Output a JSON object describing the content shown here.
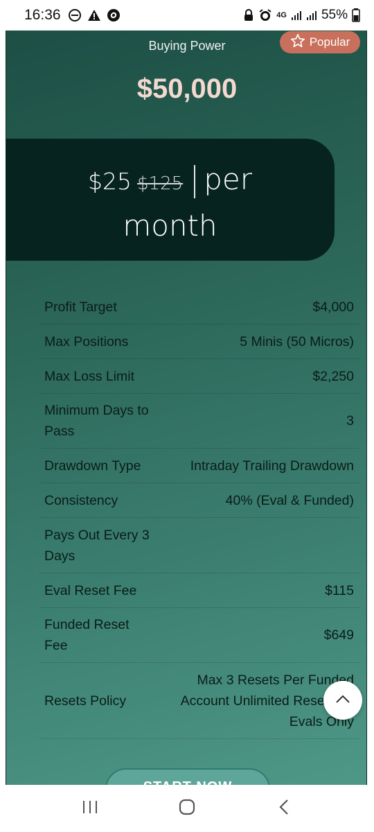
{
  "status_bar": {
    "time": "16:36",
    "left_icons": [
      "do-not-disturb-icon",
      "alert-triangle-icon",
      "shazam-icon"
    ],
    "right_icons": [
      "lock-icon",
      "alarm-icon",
      "4g-icon",
      "signal-icon",
      "signal-icon",
      "battery-icon"
    ],
    "network": "4G",
    "battery": "55%"
  },
  "plan": {
    "badge_label": "Popular",
    "buying_power_label": "Buying Power",
    "buying_power_value": "$50,000",
    "price_now": "$25",
    "price_old": "$125",
    "price_per": "per",
    "price_period": "month"
  },
  "specs": [
    {
      "label": "Profit Target",
      "value": "$4,000"
    },
    {
      "label": "Max Positions",
      "value": "5 Minis (50 Micros)"
    },
    {
      "label": "Max Loss Limit",
      "value": "$2,250"
    },
    {
      "label": "Minimum Days to Pass",
      "value": "3"
    },
    {
      "label": "Drawdown Type",
      "value": "Intraday Trailing Drawdown"
    },
    {
      "label": "Consistency",
      "value": "40% (Eval & Funded)"
    },
    {
      "label": "Pays Out Every 3 Days",
      "value": ""
    },
    {
      "label": "Eval Reset Fee",
      "value": "$115"
    },
    {
      "label": "Funded Reset Fee",
      "value": "$649"
    },
    {
      "label": "Resets Policy",
      "value": "Max 3 Resets Per Funded Account Unlimited Resets on Evals Only"
    }
  ],
  "cta": {
    "label": "START NOW"
  },
  "colors": {
    "card_dark": "#06231f",
    "accent": "#c9705c",
    "price_highlight": "#f3d9cf",
    "card_gradient_start": "#1d4f45",
    "card_gradient_end": "#4f9888"
  },
  "nav": {
    "icons": [
      "recent-apps-icon",
      "home-icon",
      "back-icon"
    ]
  }
}
